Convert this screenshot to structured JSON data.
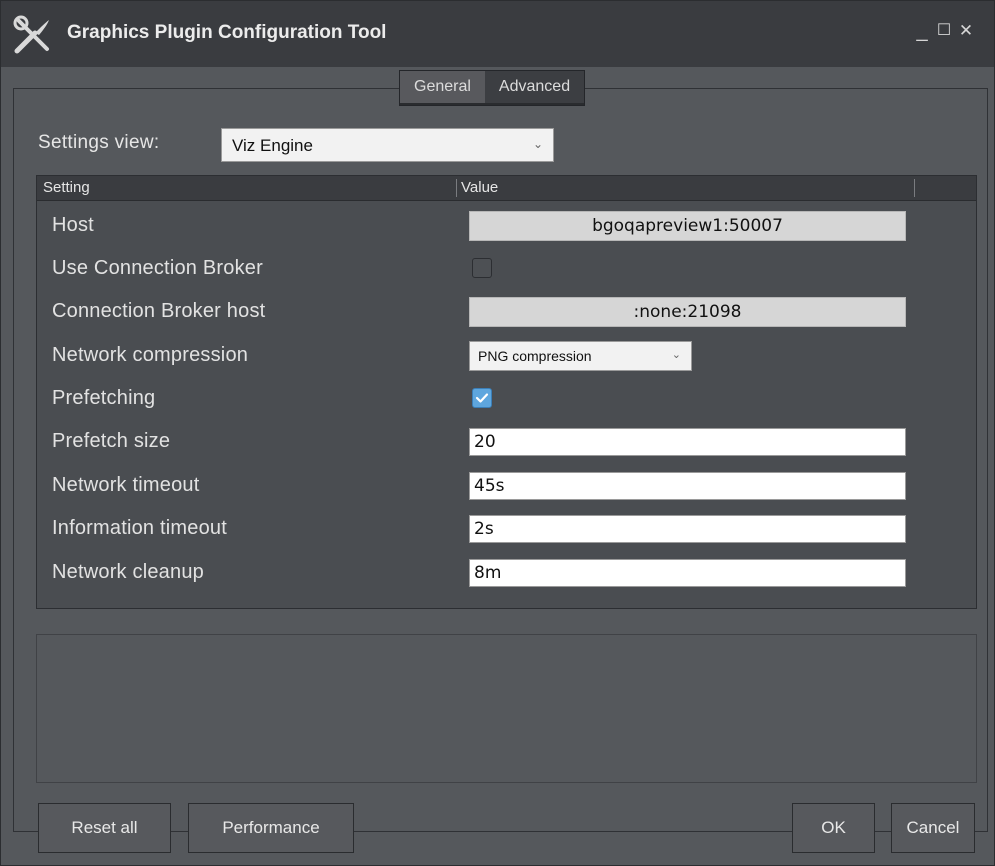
{
  "window": {
    "title": "Graphics Plugin Configuration Tool",
    "controls": {
      "minimize": "_",
      "maximize": "☐",
      "close": "✕"
    }
  },
  "tabs": [
    "General",
    "Advanced"
  ],
  "active_tab": "Advanced",
  "settings_view": {
    "label": "Settings view:",
    "value": "Viz Engine"
  },
  "grid": {
    "headers": {
      "setting": "Setting",
      "value": "Value"
    },
    "rows": [
      {
        "label": "Host",
        "type": "readonly",
        "value": "bgoqapreview1:50007"
      },
      {
        "label": "Use Connection Broker",
        "type": "checkbox",
        "checked": false
      },
      {
        "label": "Connection Broker host",
        "type": "readonly",
        "value": ":none:21098"
      },
      {
        "label": "Network compression",
        "type": "select",
        "value": "PNG compression"
      },
      {
        "label": "Prefetching",
        "type": "checkbox",
        "checked": true
      },
      {
        "label": "Prefetch size",
        "type": "text",
        "value": "20"
      },
      {
        "label": "Network timeout",
        "type": "text",
        "value": "45s"
      },
      {
        "label": "Information timeout",
        "type": "text",
        "value": "2s"
      },
      {
        "label": "Network cleanup",
        "type": "text",
        "value": "8m"
      }
    ]
  },
  "buttons": {
    "reset_all": "Reset all",
    "performance": "Performance",
    "ok": "OK",
    "cancel": "Cancel"
  },
  "icons": {
    "app": "tools-icon",
    "chevron": "chevron-down-icon",
    "check": "checkmark-icon"
  },
  "colors": {
    "checkbox_checked": "#5ea6de",
    "titlebar": "#3a3c40",
    "window_bg": "#55585c"
  }
}
